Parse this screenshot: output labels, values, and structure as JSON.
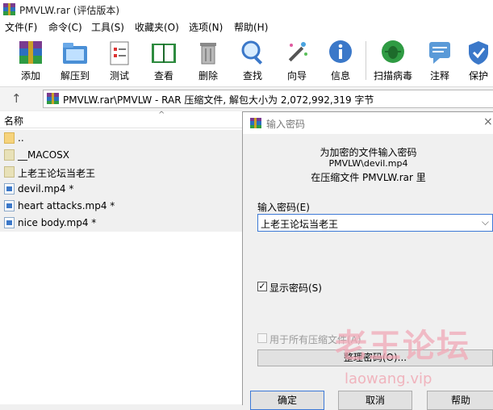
{
  "window": {
    "title": "PMVLW.rar (评估版本)"
  },
  "menu": [
    "文件(F)",
    "命令(C)",
    "工具(S)",
    "收藏夹(O)",
    "选项(N)",
    "帮助(H)"
  ],
  "toolbar": [
    {
      "label": "添加",
      "icon": "add-archive-icon"
    },
    {
      "label": "解压到",
      "icon": "extract-to-icon"
    },
    {
      "label": "测试",
      "icon": "test-icon"
    },
    {
      "label": "查看",
      "icon": "view-icon"
    },
    {
      "label": "删除",
      "icon": "delete-icon"
    },
    {
      "label": "查找",
      "icon": "find-icon"
    },
    {
      "label": "向导",
      "icon": "wizard-icon"
    },
    {
      "label": "信息",
      "icon": "info-icon"
    },
    {
      "label": "扫描病毒",
      "icon": "virus-scan-icon"
    },
    {
      "label": "注释",
      "icon": "comment-icon"
    },
    {
      "label": "保护",
      "icon": "protect-icon"
    }
  ],
  "address": {
    "path": "PMVLW.rar\\PMVLW - RAR 压缩文件, 解包大小为 2,072,992,319 字节"
  },
  "filelist": {
    "column_name": "名称",
    "items": [
      {
        "name": "..",
        "type": "folder-up"
      },
      {
        "name": "__MACOSX",
        "type": "folder"
      },
      {
        "name": "上老王论坛当老王",
        "type": "folder"
      },
      {
        "name": "devil.mp4 *",
        "type": "file"
      },
      {
        "name": "heart attacks.mp4 *",
        "type": "file"
      },
      {
        "name": "nice body.mp4 *",
        "type": "file"
      }
    ]
  },
  "dialog": {
    "title": "输入密码",
    "line1": "为加密的文件输入密码",
    "line2": "PMVLW\\devil.mp4",
    "line3": "在压缩文件 PMVLW.rar 里",
    "password_label": "输入密码(E)",
    "password_value": "上老王论坛当老王",
    "show_password_label": "显示密码(S)",
    "show_password_checked": true,
    "all_archives_label": "用于所有压缩文件(A)",
    "all_archives_checked": false,
    "organize_label": "整理密码(O)...",
    "ok_label": "确定",
    "cancel_label": "取消",
    "help_label": "帮助"
  },
  "watermark": {
    "main": "老王论坛",
    "sub": "laowang.vip"
  },
  "colors": {
    "accent": "#3d79d6",
    "watermark": "#f1a9b7"
  }
}
